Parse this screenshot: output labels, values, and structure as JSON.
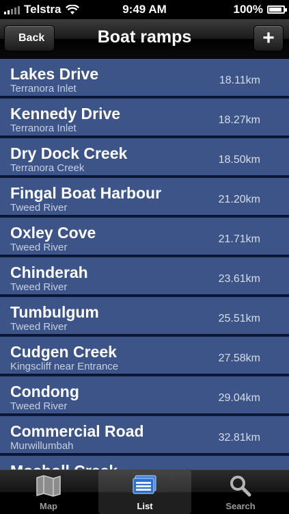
{
  "status": {
    "carrier": "Telstra",
    "time": "9:49 AM",
    "battery": "100%",
    "battery_level": 1.0
  },
  "navbar": {
    "title": "Boat ramps",
    "back_label": "Back",
    "add_label": "+"
  },
  "ramps": [
    {
      "name": "Lakes Drive",
      "location": "Terranora Inlet",
      "distance": "18.11km"
    },
    {
      "name": "Kennedy Drive",
      "location": "Terranora Inlet",
      "distance": "18.27km"
    },
    {
      "name": "Dry Dock Creek",
      "location": "Terranora Creek",
      "distance": "18.50km"
    },
    {
      "name": "Fingal Boat Harbour",
      "location": "Tweed River",
      "distance": "21.20km"
    },
    {
      "name": "Oxley Cove",
      "location": "Tweed River",
      "distance": "21.71km"
    },
    {
      "name": "Chinderah",
      "location": "Tweed River",
      "distance": "23.61km"
    },
    {
      "name": "Tumbulgum",
      "location": "Tweed River",
      "distance": "25.51km"
    },
    {
      "name": "Cudgen Creek",
      "location": "Kingscliff near Entrance",
      "distance": "27.58km"
    },
    {
      "name": "Condong",
      "location": "Tweed River",
      "distance": "29.04km"
    },
    {
      "name": "Commercial Road",
      "location": "Murwillumbah",
      "distance": "32.81km"
    },
    {
      "name": "Mosholl Creek",
      "location": "",
      "distance": ""
    }
  ],
  "tabs": [
    {
      "label": "Map",
      "icon": "map-icon"
    },
    {
      "label": "List",
      "icon": "list-icon",
      "active": true
    },
    {
      "label": "Search",
      "icon": "search-icon"
    }
  ]
}
